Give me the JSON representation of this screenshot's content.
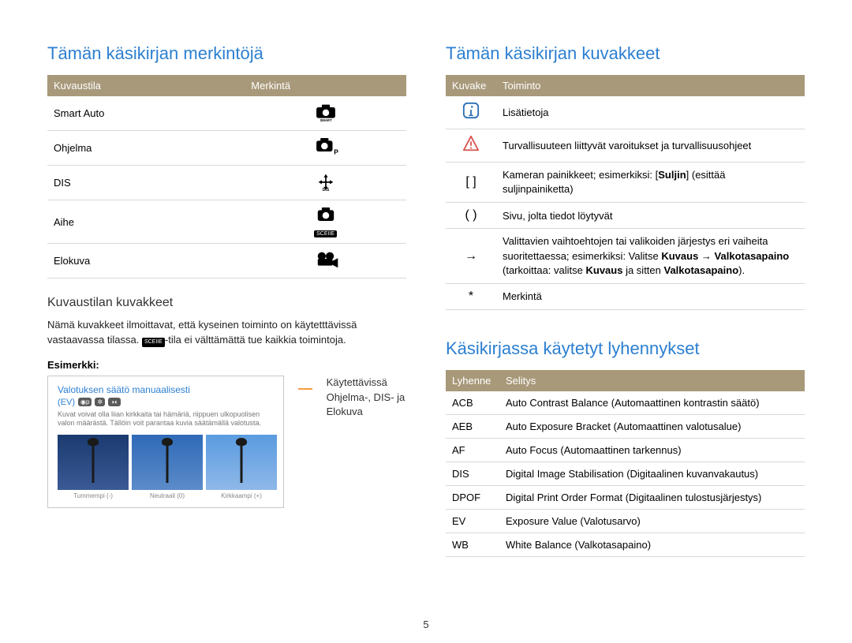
{
  "left": {
    "heading": "Tämän käsikirjan merkintöjä",
    "modes_header": {
      "col1": "Kuvaustila",
      "col2": "Merkintä"
    },
    "modes": [
      {
        "name": "Smart Auto"
      },
      {
        "name": "Ohjelma"
      },
      {
        "name": "DIS"
      },
      {
        "name": "Aihe"
      },
      {
        "name": "Elokuva"
      }
    ],
    "sub_heading": "Kuvaustilan kuvakkeet",
    "sub_body_pre": "Nämä kuvakkeet ilmoittavat, että kyseinen toiminto on käytetttävissä vastaavassa tilassa. ",
    "sub_body_post": "-tila ei välttämättä tue kaikkia toimintoja.",
    "example_label": "Esimerkki:",
    "example": {
      "title": "Valotuksen säätö manuaalisesti",
      "ev_label": "(EV)",
      "body": "Kuvat voivat olla liian kirkkaita tai hämäriä, riippuen ulkopuolisen valon määrästä. Tällöin voit parantaa kuvia säätämällä valotusta.",
      "thumbs": [
        "Tummempi (-)",
        "Neutraali (0)",
        "Kirkkaampi (+)"
      ]
    },
    "caption_right": "Käytettävissä Ohjelma-, DIS- ja Elokuva"
  },
  "right": {
    "heading1": "Tämän käsikirjan kuvakkeet",
    "icons_header": {
      "col1": "Kuvake",
      "col2": "Toiminto"
    },
    "icons": [
      {
        "sym": "info",
        "text": "Lisätietoja"
      },
      {
        "sym": "warn",
        "text": "Turvallisuuteen liittyvät varoitukset ja turvallisuusohjeet"
      },
      {
        "sym": "[ ]",
        "text_pre": "Kameran painikkeet; esimerkiksi: [",
        "text_bold": "Suljin",
        "text_mid": "] (esittää suljinpainiketta)"
      },
      {
        "sym": "( )",
        "text": "Sivu, jolta tiedot löytyvät"
      },
      {
        "sym": "→",
        "long_1": "Valittavien vaihtoehtojen tai valikoiden järjestys eri vaiheita suoritettaessa; esimerkiksi: Valitse ",
        "b1": "Kuvaus",
        "a1": " → ",
        "b2": "Valkotasapaino",
        "p2": " (tarkoittaa: valitse ",
        "b3": "Kuvaus",
        "p3": " ja sitten ",
        "b4": "Valkotasapaino",
        "p4": ")."
      },
      {
        "sym": "*",
        "text": "Merkintä"
      }
    ],
    "heading2": "Käsikirjassa käytetyt lyhennykset",
    "abbr_header": {
      "col1": "Lyhenne",
      "col2": "Selitys"
    },
    "abbr": [
      {
        "a": "ACB",
        "d": "Auto Contrast Balance (Automaattinen kontrastin säätö)"
      },
      {
        "a": "AEB",
        "d": "Auto Exposure Bracket (Automaattinen valotusalue)"
      },
      {
        "a": "AF",
        "d": "Auto Focus (Automaattinen tarkennus)"
      },
      {
        "a": "DIS",
        "d": "Digital Image Stabilisation (Digitaalinen kuvanvakautus)"
      },
      {
        "a": "DPOF",
        "d": "Digital Print Order Format (Digitaalinen tulostusjärjestys)"
      },
      {
        "a": "EV",
        "d": "Exposure Value (Valotusarvo)"
      },
      {
        "a": "WB",
        "d": "White Balance (Valkotasapaino)"
      }
    ]
  },
  "page_number": "5"
}
